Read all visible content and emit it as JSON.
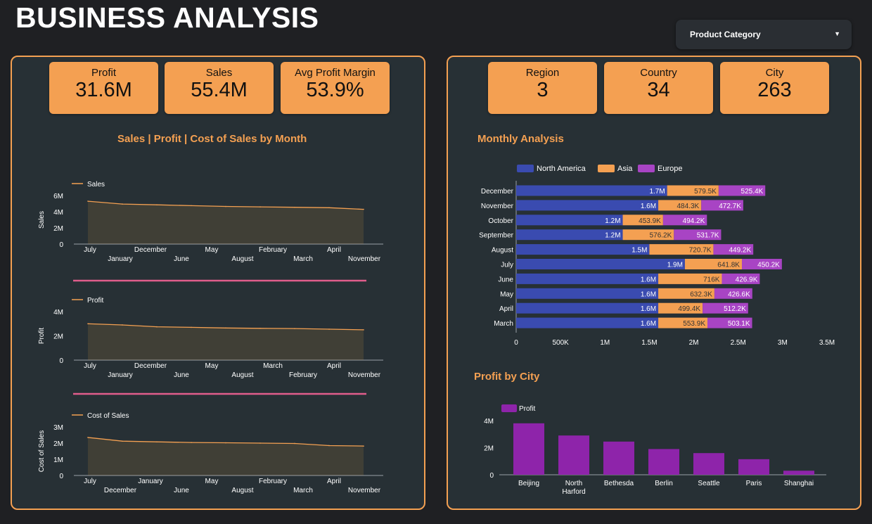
{
  "page": {
    "title": "BUSINESS ANALYSIS"
  },
  "filter": {
    "label": "Product Category"
  },
  "kpis_left": [
    {
      "label": "Profit",
      "value": "31.6M"
    },
    {
      "label": "Sales",
      "value": "55.4M"
    },
    {
      "label": "Avg Profit Margin",
      "value": "53.9%"
    }
  ],
  "kpis_right": [
    {
      "label": "Region",
      "value": "3"
    },
    {
      "label": "Country",
      "value": "34"
    },
    {
      "label": "City",
      "value": "263"
    }
  ],
  "colors": {
    "accent": "#f4a052",
    "panel": "#273035",
    "divider": "#e05d8c",
    "north_america": "#3a4bb0",
    "asia": "#f4a052",
    "europe": "#a844c4",
    "city_bar": "#8e24aa"
  },
  "chart_titles": {
    "left": "Sales | Profit | Cost of Sales by Month",
    "monthly": "Monthly Analysis",
    "city": "Profit by City"
  },
  "chart_data": [
    {
      "type": "area",
      "legend": "Sales",
      "ylabel": "Sales",
      "yticks": [
        "0",
        "2M",
        "4M",
        "6M"
      ],
      "ylim": [
        0,
        6
      ],
      "xticks_top": [
        "July",
        "December",
        "May",
        "February",
        "April"
      ],
      "xticks_bottom": [
        "January",
        "June",
        "August",
        "March",
        "November"
      ],
      "values": [
        5.3,
        4.95,
        4.85,
        4.75,
        4.65,
        4.6,
        4.55,
        4.5,
        4.3
      ]
    },
    {
      "type": "area",
      "legend": "Profit",
      "ylabel": "Profit",
      "yticks": [
        "0",
        "2M",
        "4M"
      ],
      "ylim": [
        0,
        4
      ],
      "xticks_top": [
        "July",
        "December",
        "May",
        "March",
        "April"
      ],
      "xticks_bottom": [
        "January",
        "June",
        "August",
        "February",
        "November"
      ],
      "values": [
        3.0,
        2.9,
        2.75,
        2.7,
        2.65,
        2.62,
        2.6,
        2.55,
        2.5
      ]
    },
    {
      "type": "area",
      "legend": "Cost of Sales",
      "ylabel": "Cost of Sales",
      "yticks": [
        "0",
        "1M",
        "2M",
        "3M"
      ],
      "ylim": [
        0,
        3
      ],
      "xticks_top": [
        "July",
        "January",
        "May",
        "February",
        "April"
      ],
      "xticks_bottom": [
        "December",
        "June",
        "August",
        "March",
        "November"
      ],
      "values": [
        2.35,
        2.12,
        2.08,
        2.04,
        2.02,
        2.0,
        1.98,
        1.85,
        1.82
      ]
    },
    {
      "type": "bar",
      "orientation": "horizontal",
      "stacked": true,
      "categories": [
        "December",
        "November",
        "October",
        "September",
        "August",
        "July",
        "June",
        "May",
        "April",
        "March"
      ],
      "series": [
        {
          "name": "North America",
          "values": [
            1.7,
            1.6,
            1.2,
            1.2,
            1.5,
            1.9,
            1.6,
            1.6,
            1.6,
            1.6
          ],
          "labels": [
            "1.7M",
            "1.6M",
            "1.2M",
            "1.2M",
            "1.5M",
            "1.9M",
            "1.6M",
            "1.6M",
            "1.6M",
            "1.6M"
          ]
        },
        {
          "name": "Asia",
          "values": [
            0.5795,
            0.4843,
            0.4539,
            0.5762,
            0.7207,
            0.6418,
            0.716,
            0.6323,
            0.4994,
            0.5539
          ],
          "labels": [
            "579.5K",
            "484.3K",
            "453.9K",
            "576.2K",
            "720.7K",
            "641.8K",
            "716K",
            "632.3K",
            "499.4K",
            "553.9K"
          ]
        },
        {
          "name": "Europe",
          "values": [
            0.5254,
            0.4727,
            0.4942,
            0.5317,
            0.4492,
            0.4502,
            0.4269,
            0.4266,
            0.5122,
            0.5031
          ],
          "labels": [
            "525.4K",
            "472.7K",
            "494.2K",
            "531.7K",
            "449.2K",
            "450.2K",
            "426.9K",
            "426.6K",
            "512.2K",
            "503.1K"
          ]
        }
      ],
      "xticks": [
        "0",
        "500K",
        "1M",
        "1.5M",
        "2M",
        "2.5M",
        "3M",
        "3.5M"
      ],
      "xlim": [
        0,
        3.5
      ],
      "legend": "top-left"
    },
    {
      "type": "bar",
      "legend": "Profit",
      "categories": [
        "Beijing",
        "North Harford",
        "Bethesda",
        "Berlin",
        "Seattle",
        "Paris",
        "Shanghai"
      ],
      "category_lines": [
        [
          "Beijing"
        ],
        [
          "North",
          "Harford"
        ],
        [
          "Bethesda"
        ],
        [
          "Berlin"
        ],
        [
          "Seattle"
        ],
        [
          "Paris"
        ],
        [
          "Shanghai"
        ]
      ],
      "values": [
        3.8,
        2.9,
        2.45,
        1.9,
        1.6,
        1.15,
        0.3
      ],
      "yticks": [
        "0",
        "2M",
        "4M"
      ],
      "ylim": [
        0,
        4
      ]
    }
  ]
}
